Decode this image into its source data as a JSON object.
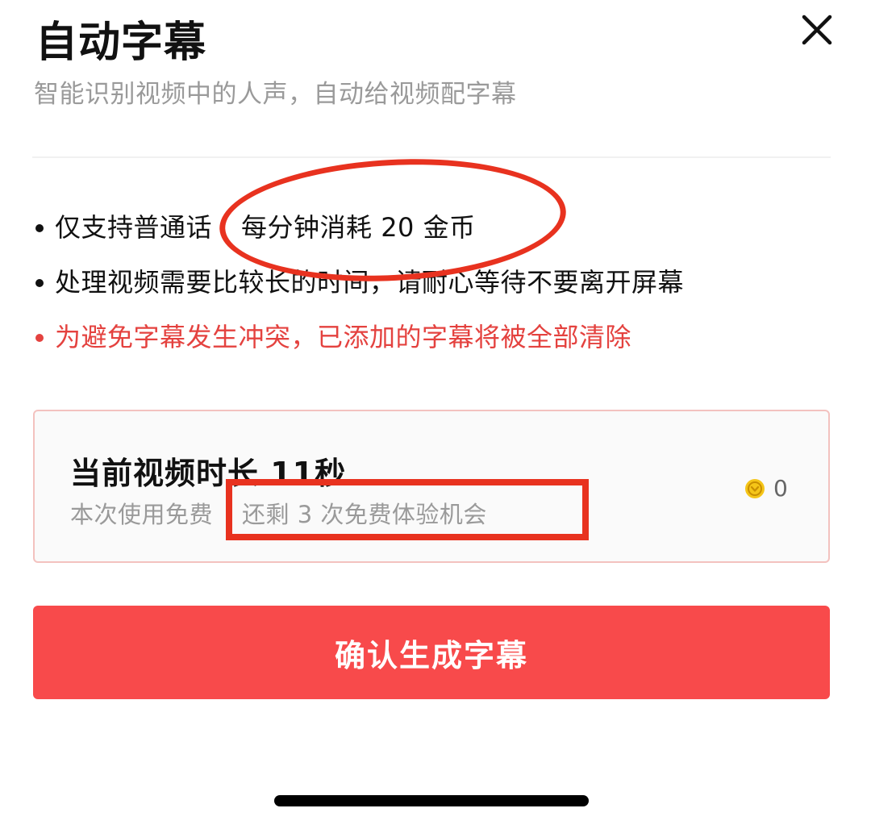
{
  "dialog": {
    "title": "自动字幕",
    "subtitle": "智能识别视频中的人声，自动给视频配字幕",
    "close_icon": "close-icon"
  },
  "notes": {
    "items": [
      {
        "prefix": "仅支持普通话",
        "highlight": "每分钟消耗 20 金币"
      },
      {
        "text": "处理视频需要比较长的时间，请耐心等待不要离开屏幕"
      },
      {
        "text": "为避免字幕发生冲突，已添加的字幕将被全部清除"
      }
    ]
  },
  "duration_card": {
    "title": "当前视频时长 11秒",
    "usage_prefix": "本次使用免费",
    "usage_highlight": "还剩 3 次免费体验机会",
    "coin_icon": "gold-coin-icon",
    "coin_value": "0"
  },
  "confirm_button": {
    "label": "确认生成字幕"
  },
  "colors": {
    "accent": "#f84a4b",
    "warning_text": "#e4423f",
    "annotation": "#e8321f",
    "card_border": "#f3c2bf",
    "coin": "#f5c518"
  }
}
